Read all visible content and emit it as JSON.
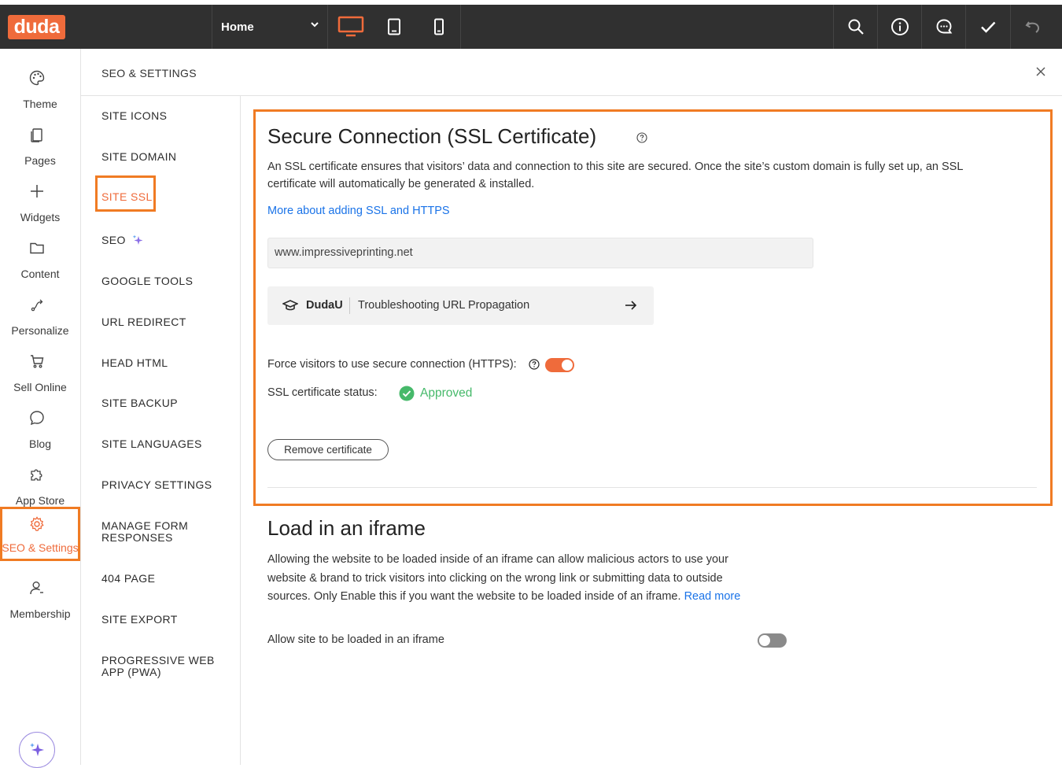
{
  "topbar": {
    "logo_text": "duda",
    "page_selector": {
      "value": "Home"
    },
    "devices": [
      "desktop-icon",
      "tablet-icon",
      "mobile-icon"
    ],
    "active_device": "desktop",
    "tools": [
      "search-icon",
      "info-icon",
      "comment-icon",
      "check-icon",
      "undo-icon"
    ]
  },
  "rail": {
    "items": [
      {
        "label": "Theme",
        "icon": "palette-icon"
      },
      {
        "label": "Pages",
        "icon": "pages-icon"
      },
      {
        "label": "Widgets",
        "icon": "plus-icon"
      },
      {
        "label": "Content",
        "icon": "folder-icon"
      },
      {
        "label": "Personalize",
        "icon": "personalize-icon"
      },
      {
        "label": "Sell Online",
        "icon": "cart-icon"
      },
      {
        "label": "Blog",
        "icon": "chat-bubble-icon"
      },
      {
        "label": "App Store",
        "icon": "puzzle-icon"
      },
      {
        "label": "SEO & Settings",
        "icon": "gear-icon"
      },
      {
        "label": "Membership",
        "icon": "person-icon"
      }
    ],
    "active": "SEO & Settings"
  },
  "panel": {
    "title": "SEO & SETTINGS"
  },
  "nav": {
    "items": [
      "SITE ICONS",
      "SITE DOMAIN",
      "SITE SSL",
      "SEO",
      "GOOGLE TOOLS",
      "URL REDIRECT",
      "HEAD HTML",
      "SITE BACKUP",
      "SITE LANGUAGES",
      "PRIVACY SETTINGS",
      "MANAGE FORM",
      "RESPONSES",
      "404 PAGE",
      "SITE EXPORT",
      "PROGRESSIVE WEB",
      "APP (PWA)"
    ],
    "active": "SITE SSL"
  },
  "ssl": {
    "title": "Secure Connection (SSL Certificate)",
    "description_line1": "An SSL certificate ensures that visitors’ data and connection to this site are secured. Once the site’s custom domain is fully set up, an SSL",
    "description_line2": "certificate will automatically be generated & installed.",
    "learn_more": "More about adding SSL and HTTPS",
    "domain": "www.impressiveprinting.net",
    "dudau_brand": "DudaU",
    "dudau_title": "Troubleshooting URL Propagation",
    "force_https_label": "Force visitors to use secure connection (HTTPS):",
    "force_https_enabled": true,
    "status_label": "SSL certificate status:",
    "status_value": "Approved",
    "remove_button": "Remove certificate"
  },
  "iframe": {
    "title": "Load in an iframe",
    "description_line1": "Allowing the website to be loaded inside of an iframe can allow malicious actors to use your",
    "description_line2": "website & brand to trick visitors into clicking on the wrong link or submitting data to outside",
    "description_line3": "sources. Only Enable this if you want the website to be loaded inside of an iframe.",
    "read_more": "Read more",
    "allow_label": "Allow site to be loaded in an iframe",
    "allow_enabled": false
  },
  "colors": {
    "brand_orange": "#ef6b3b",
    "highlight_orange": "#f07b23",
    "link_blue": "#1a73e8",
    "approved_green": "#46b96a",
    "topbar_bg": "#303030"
  }
}
